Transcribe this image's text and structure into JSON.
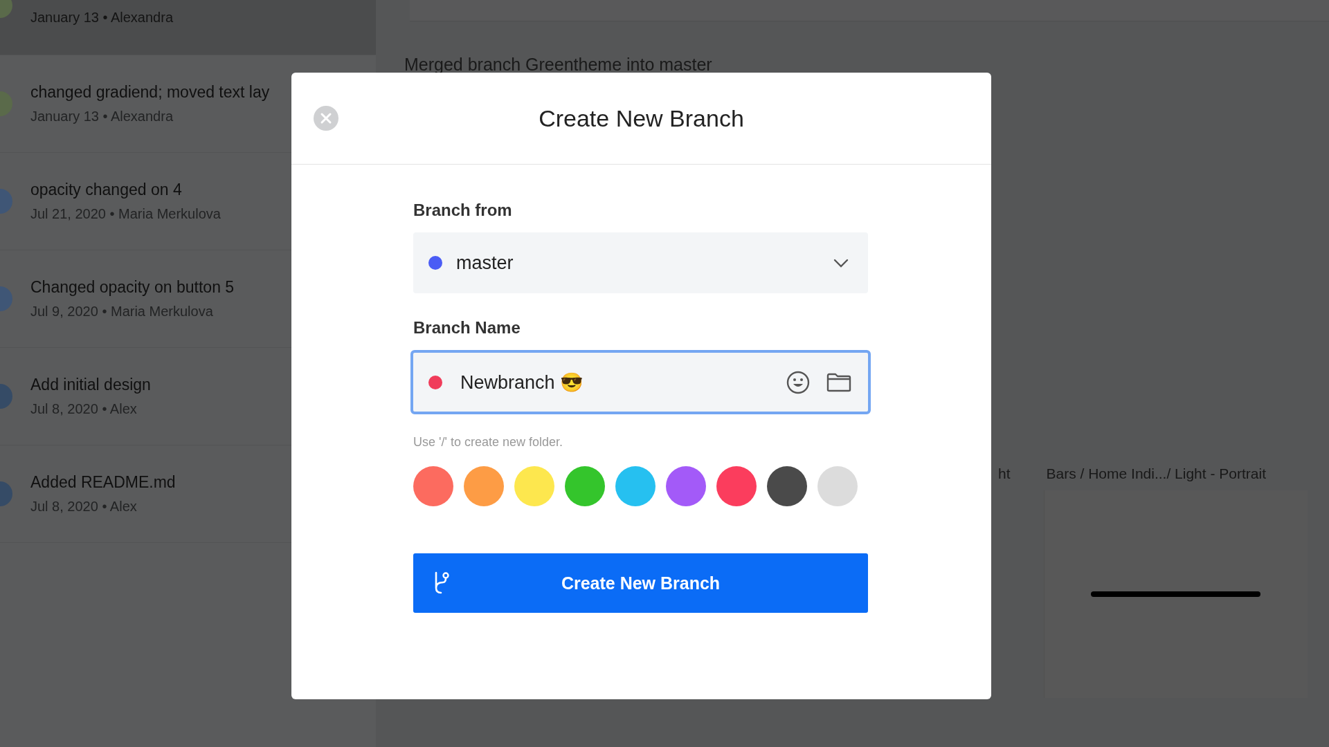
{
  "sidebar": {
    "commits": [
      {
        "meta": "January 13 • Alexandra",
        "selected": true,
        "color": "#5a6a4a"
      },
      {
        "title": "changed gradiend; moved text lay",
        "meta": "January 13 • Alexandra",
        "selected": false,
        "color": "#5a6a4a"
      },
      {
        "title": "opacity changed on 4",
        "meta": "Jul 21, 2020 • Maria Merkulova",
        "selected": false,
        "color": "#3f5676"
      },
      {
        "title": "Changed opacity on button 5",
        "meta": "Jul 9, 2020 • Maria Merkulova",
        "selected": false,
        "color": "#3f5676"
      },
      {
        "title": "Add initial design",
        "meta": "Jul 8, 2020 • Alex",
        "selected": false,
        "color": "#354b66"
      },
      {
        "title": "Added README.md",
        "meta": "Jul 8, 2020 • Alex",
        "selected": false,
        "color": "#354b66"
      }
    ]
  },
  "detail": {
    "commit_title": "Merged branch Greentheme into master",
    "artboard_labels": [
      "ht",
      "Bars / Home Indi.../ Light - Portrait"
    ]
  },
  "dialog": {
    "title": "Create New Branch",
    "branch_from": {
      "label": "Branch from",
      "value": "master",
      "color": "#4a5cf5"
    },
    "branch_name": {
      "label": "Branch Name",
      "value": "Newbranch 😎",
      "color": "#f03c5a"
    },
    "hint": "Use '/' to create new folder.",
    "swatches": [
      {
        "color": "#fc6b5f"
      },
      {
        "color": "#fd9c45"
      },
      {
        "color": "#fde74e"
      },
      {
        "color": "#34c52c"
      },
      {
        "color": "#26c0f0"
      },
      {
        "color": "#a35af8"
      },
      {
        "color": "#fb3d5d"
      },
      {
        "color": "#4a4a4a"
      },
      {
        "color": "#dcdcdc"
      }
    ],
    "button": "Create New Branch"
  }
}
